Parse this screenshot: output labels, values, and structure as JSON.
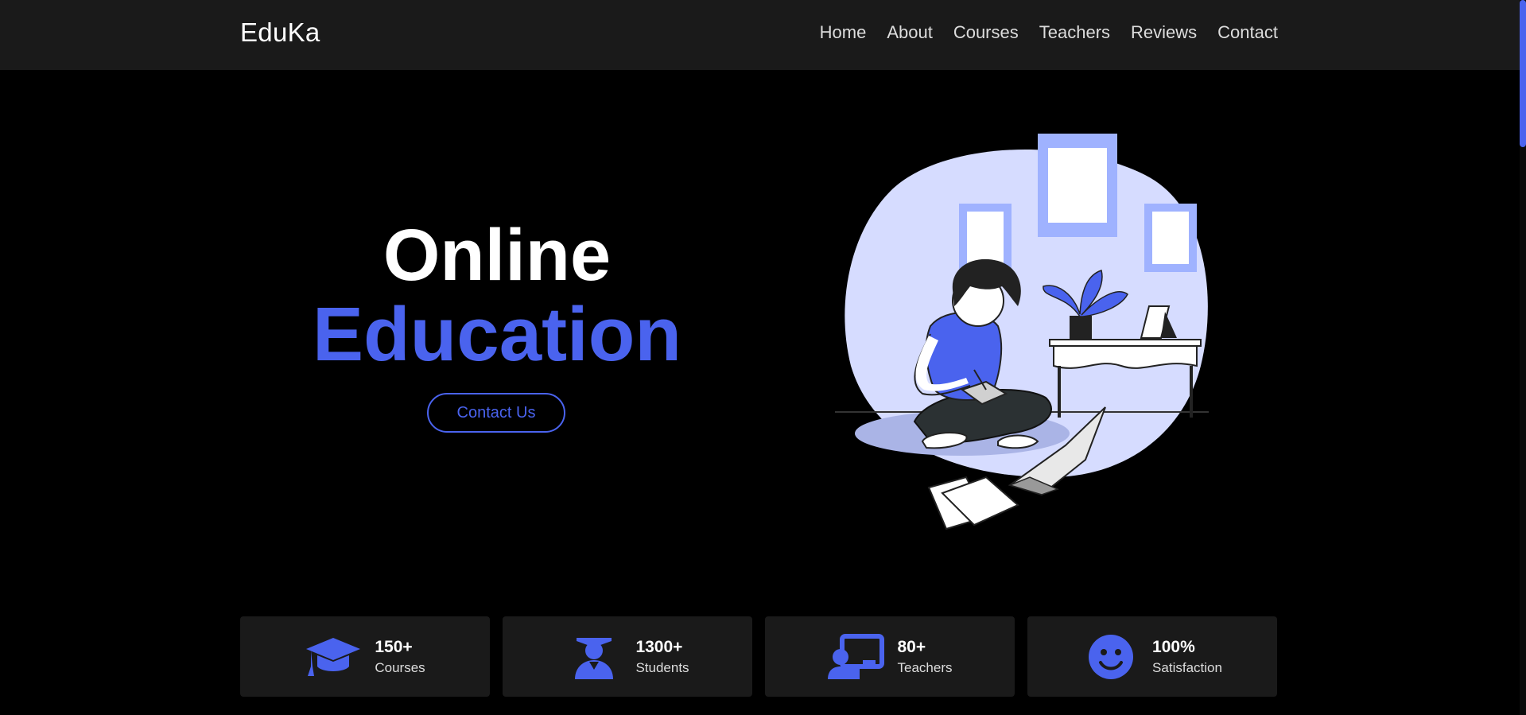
{
  "brand": "EduKa",
  "nav": [
    "Home",
    "About",
    "Courses",
    "Teachers",
    "Reviews",
    "Contact"
  ],
  "hero": {
    "line1": "Online",
    "line2": "Education",
    "button": "Contact Us"
  },
  "stats": [
    {
      "value": "150+",
      "label": "Courses",
      "icon": "graduation-cap-icon"
    },
    {
      "value": "1300+",
      "label": "Students",
      "icon": "student-icon"
    },
    {
      "value": "80+",
      "label": "Teachers",
      "icon": "teacher-icon"
    },
    {
      "value": "100%",
      "label": "Satisfaction",
      "icon": "smile-icon"
    }
  ],
  "colors": {
    "accent": "#4a63ee",
    "navbar": "#1a1a1a",
    "background": "#000000",
    "card": "#1a1a1a",
    "illustration_bg": "#d6dcff"
  }
}
